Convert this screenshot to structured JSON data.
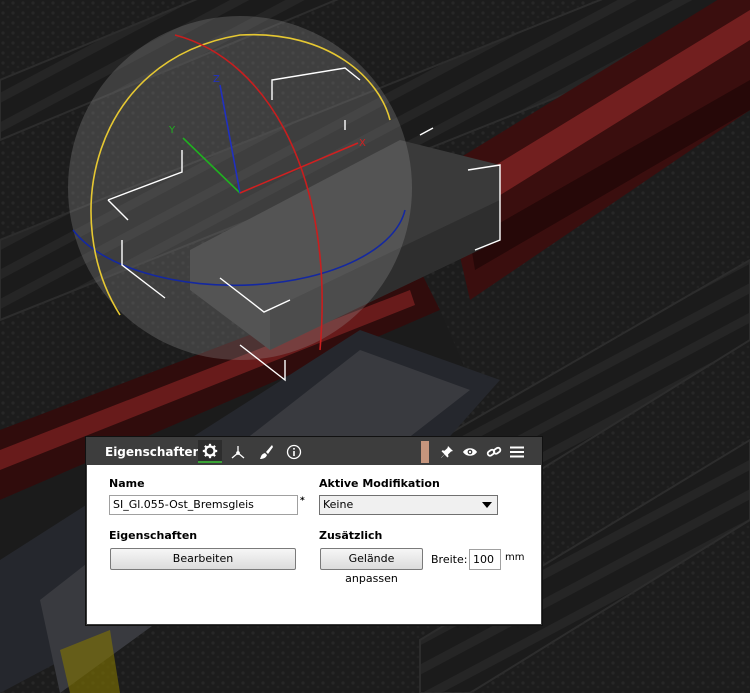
{
  "panel": {
    "title": "Eigenschaften",
    "tabs": [
      "settings-icon",
      "axes-icon",
      "brush-icon",
      "info-icon"
    ],
    "header_buttons": [
      "pin-icon",
      "eye-icon",
      "link-icon",
      "menu-icon"
    ],
    "accent_color": "#c5957d",
    "active_tab_color": "#3aa335"
  },
  "name_section": {
    "label": "Name",
    "value": "SI_Gl.055-Ost_Bremsgleis",
    "modified_marker": "*"
  },
  "modification_section": {
    "label": "Aktive Modifikation",
    "selected": "Keine"
  },
  "properties_section": {
    "label": "Eigenschaften",
    "edit_button": "Bearbeiten"
  },
  "extra_section": {
    "label": "Zusätzlich",
    "terrain_button": "Gelände anpassen",
    "width_label": "Breite:",
    "width_value": "100",
    "width_unit": "mm"
  },
  "gizmo": {
    "x_label": "X",
    "y_label": "Y",
    "z_label": "Z",
    "x_color": "#d02020",
    "y_color": "#20b020",
    "z_color": "#2030c0",
    "ring_yellow": "#e6c832",
    "ring_blue": "#1428a0",
    "ring_red": "#c81e1e"
  }
}
